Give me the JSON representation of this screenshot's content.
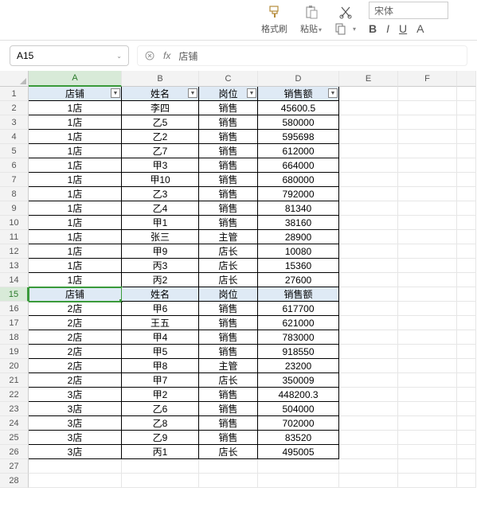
{
  "toolbar": {
    "format_painter": "格式刷",
    "paste": "粘贴",
    "cut_icon": "cut",
    "copy_icon": "copy",
    "font_name": "宋体",
    "bold": "B",
    "italic": "I",
    "underline": "U",
    "strike": "A"
  },
  "namebox": {
    "ref": "A15",
    "fx": "fx",
    "formula": "店铺"
  },
  "columns": [
    "A",
    "B",
    "C",
    "D",
    "E",
    "F"
  ],
  "row_count": 28,
  "selected_row": 15,
  "selected_col": "A",
  "chart_data": {
    "type": "table",
    "headers": [
      "店铺",
      "姓名",
      "岗位",
      "销售额"
    ],
    "rows": [
      [
        "店铺",
        "姓名",
        "岗位",
        "销售额"
      ],
      [
        "1店",
        "李四",
        "销售",
        "45600.5"
      ],
      [
        "1店",
        "乙5",
        "销售",
        "580000"
      ],
      [
        "1店",
        "乙2",
        "销售",
        "595698"
      ],
      [
        "1店",
        "乙7",
        "销售",
        "612000"
      ],
      [
        "1店",
        "甲3",
        "销售",
        "664000"
      ],
      [
        "1店",
        "甲10",
        "销售",
        "680000"
      ],
      [
        "1店",
        "乙3",
        "销售",
        "792000"
      ],
      [
        "1店",
        "乙4",
        "销售",
        "81340"
      ],
      [
        "1店",
        "甲1",
        "销售",
        "38160"
      ],
      [
        "1店",
        "张三",
        "主管",
        "28900"
      ],
      [
        "1店",
        "甲9",
        "店长",
        "10080"
      ],
      [
        "1店",
        "丙3",
        "店长",
        "15360"
      ],
      [
        "1店",
        "丙2",
        "店长",
        "27600"
      ],
      [
        "店铺",
        "姓名",
        "岗位",
        "销售额"
      ],
      [
        "2店",
        "甲6",
        "销售",
        "617700"
      ],
      [
        "2店",
        "王五",
        "销售",
        "621000"
      ],
      [
        "2店",
        "甲4",
        "销售",
        "783000"
      ],
      [
        "2店",
        "甲5",
        "销售",
        "918550"
      ],
      [
        "2店",
        "甲8",
        "主管",
        "23200"
      ],
      [
        "2店",
        "甲7",
        "店长",
        "350009"
      ],
      [
        "3店",
        "甲2",
        "销售",
        "448200.3"
      ],
      [
        "3店",
        "乙6",
        "销售",
        "504000"
      ],
      [
        "3店",
        "乙8",
        "销售",
        "702000"
      ],
      [
        "3店",
        "乙9",
        "销售",
        "83520"
      ],
      [
        "3店",
        "丙1",
        "店长",
        "495005"
      ]
    ]
  }
}
